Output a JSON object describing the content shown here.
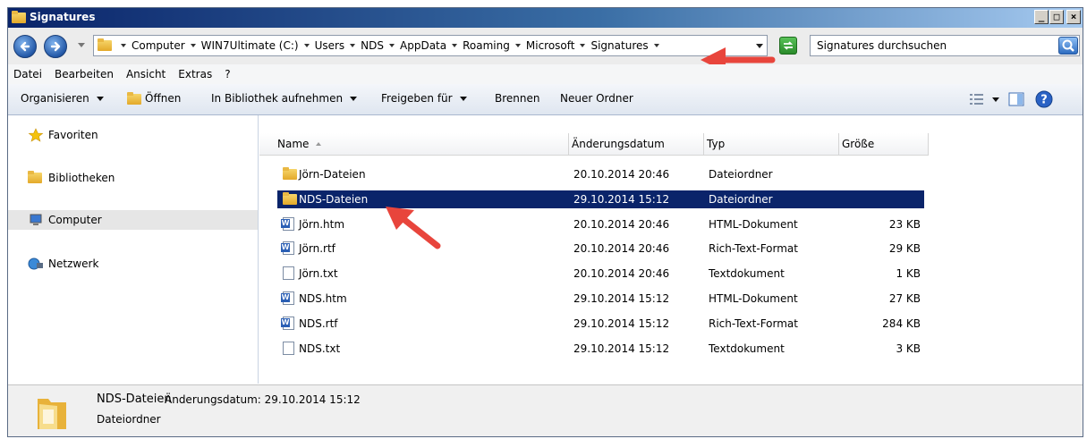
{
  "window": {
    "title": "Signatures"
  },
  "address": {
    "breadcrumbs": [
      "Computer",
      "WIN7Ultimate (C:)",
      "Users",
      "NDS",
      "AppData",
      "Roaming",
      "Microsoft",
      "Signatures"
    ]
  },
  "search": {
    "placeholder": "Signatures durchsuchen"
  },
  "menu": {
    "items": [
      "Datei",
      "Bearbeiten",
      "Ansicht",
      "Extras",
      "?"
    ]
  },
  "toolbar": {
    "organize": "Organisieren",
    "open": "Öffnen",
    "include_library": "In Bibliothek aufnehmen",
    "share": "Freigeben für",
    "burn": "Brennen",
    "new_folder": "Neuer Ordner"
  },
  "nav": {
    "favorites": "Favoriten",
    "libraries": "Bibliotheken",
    "computer": "Computer",
    "network": "Netzwerk"
  },
  "columns": {
    "name": "Name",
    "date": "Änderungsdatum",
    "type": "Typ",
    "size": "Größe"
  },
  "files": [
    {
      "name": "Jörn-Dateien",
      "date": "20.10.2014 20:46",
      "type": "Dateiordner",
      "size": "",
      "icon": "folder-icon"
    },
    {
      "name": "NDS-Dateien",
      "date": "29.10.2014 15:12",
      "type": "Dateiordner",
      "size": "",
      "icon": "folder-icon",
      "selected": true
    },
    {
      "name": "Jörn.htm",
      "date": "20.10.2014 20:46",
      "type": "HTML-Dokument",
      "size": "23 KB",
      "icon": "word-doc-icon"
    },
    {
      "name": "Jörn.rtf",
      "date": "20.10.2014 20:46",
      "type": "Rich-Text-Format",
      "size": "29 KB",
      "icon": "word-doc-icon"
    },
    {
      "name": "Jörn.txt",
      "date": "20.10.2014 20:46",
      "type": "Textdokument",
      "size": "1 KB",
      "icon": "text-doc-icon"
    },
    {
      "name": "NDS.htm",
      "date": "29.10.2014 15:12",
      "type": "HTML-Dokument",
      "size": "27 KB",
      "icon": "word-doc-icon"
    },
    {
      "name": "NDS.rtf",
      "date": "29.10.2014 15:12",
      "type": "Rich-Text-Format",
      "size": "284 KB",
      "icon": "word-doc-icon"
    },
    {
      "name": "NDS.txt",
      "date": "29.10.2014 15:12",
      "type": "Textdokument",
      "size": "3 KB",
      "icon": "text-doc-icon"
    }
  ],
  "details": {
    "name": "NDS-Dateien",
    "meta": "Änderungsdatum: 29.10.2014 15:12",
    "type": "Dateiordner"
  },
  "colors": {
    "selection": "#0a246a",
    "annotation_arrow": "#e8453c"
  }
}
